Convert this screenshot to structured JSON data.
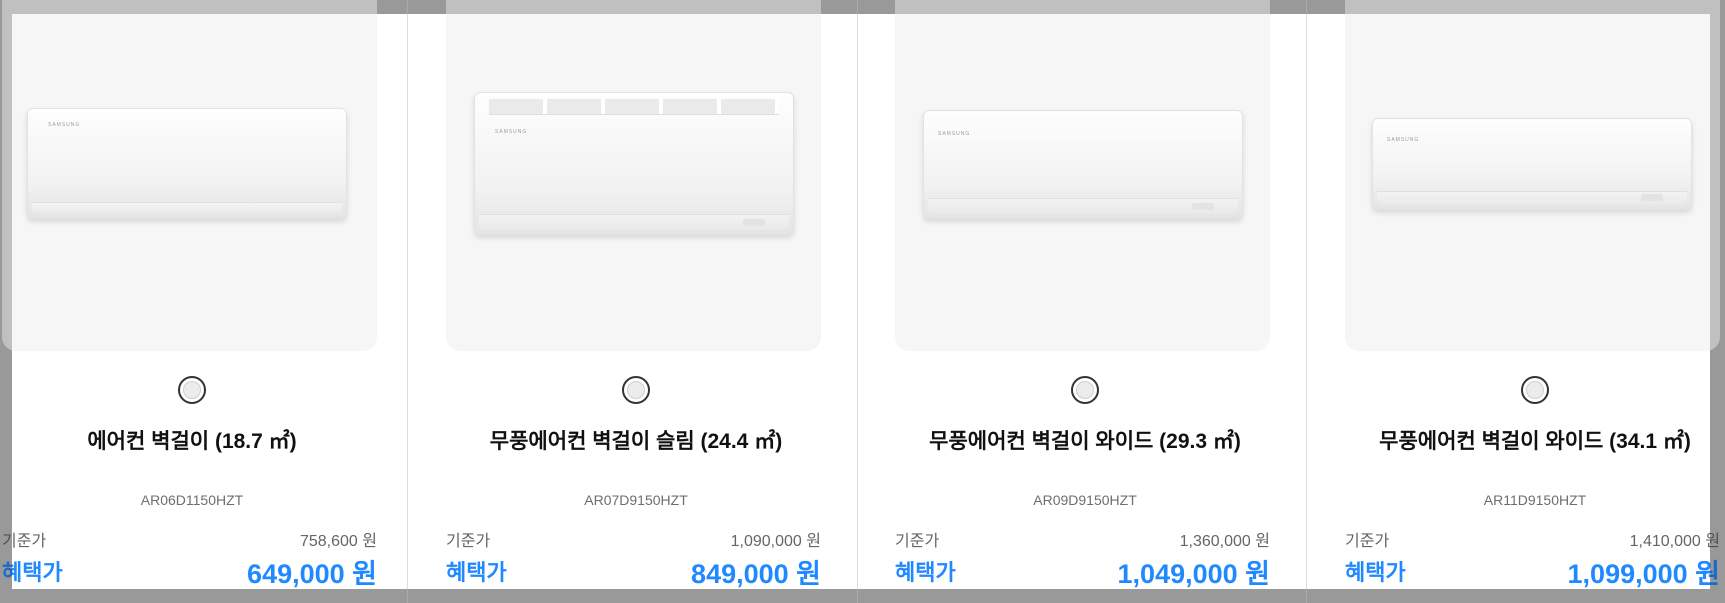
{
  "products": [
    {
      "name": "에어컨 벽걸이 (18.7 ㎡)",
      "model": "AR06D1150HZT",
      "base_label": "기준가",
      "base_price": "758,600 원",
      "sale_label": "혜택가",
      "sale_price": "649,000 원",
      "image_icon": "wall-air-conditioner",
      "brand": "SAMSUNG",
      "swatch_color": "#ececec"
    },
    {
      "name": "무풍에어컨 벽걸이 슬림 (24.4 ㎡)",
      "model": "AR07D9150HZT",
      "base_label": "기준가",
      "base_price": "1,090,000 원",
      "sale_label": "혜택가",
      "sale_price": "849,000 원",
      "image_icon": "wall-air-conditioner",
      "brand": "SAMSUNG",
      "swatch_color": "#ececec"
    },
    {
      "name": "무풍에어컨 벽걸이 와이드 (29.3 ㎡)",
      "model": "AR09D9150HZT",
      "base_label": "기준가",
      "base_price": "1,360,000 원",
      "sale_label": "혜택가",
      "sale_price": "1,049,000 원",
      "image_icon": "wall-air-conditioner",
      "brand": "SAMSUNG",
      "swatch_color": "#ececec"
    },
    {
      "name": "무풍에어컨 벽걸이 와이드 (34.1 ㎡)",
      "model": "AR11D9150HZT",
      "base_label": "기준가",
      "base_price": "1,410,000 원",
      "sale_label": "혜택가",
      "sale_price": "1,099,000 원",
      "image_icon": "wall-air-conditioner",
      "brand": "SAMSUNG",
      "swatch_color": "#ececec"
    }
  ],
  "colors": {
    "accent": "#2189ff",
    "text": "#111111",
    "muted": "#666666",
    "image_bg": "#f6f6f6",
    "overlay": "#c5c5c5"
  }
}
